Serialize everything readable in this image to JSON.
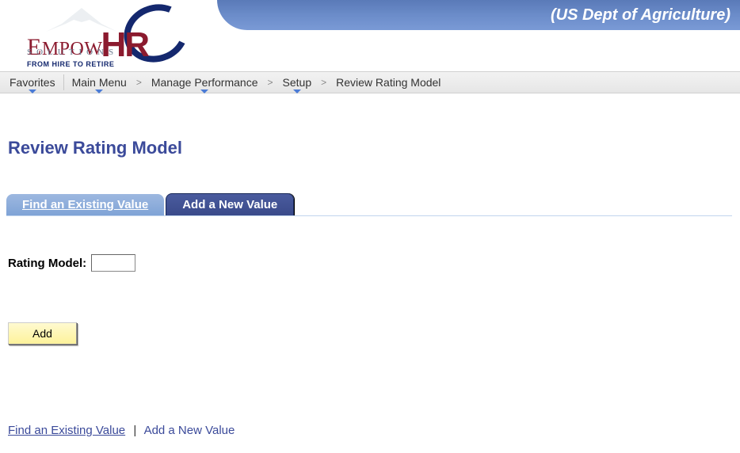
{
  "header": {
    "org_label": "(US Dept of Agriculture)",
    "logo": {
      "brand_prefix": "E",
      "brand_rest": "MPOW",
      "brand_suffix": "HR",
      "solutions": "SOLUTIONS",
      "tagline": "FROM HIRE TO RETIRE"
    }
  },
  "breadcrumb": {
    "items": [
      {
        "label": "Favorites",
        "has_menu": true
      },
      {
        "label": "Main Menu",
        "has_menu": true
      },
      {
        "label": "Manage Performance",
        "has_menu": true
      },
      {
        "label": "Setup",
        "has_menu": true
      },
      {
        "label": "Review Rating Model",
        "has_menu": false
      }
    ],
    "separator": ">"
  },
  "page": {
    "title": "Review Rating Model"
  },
  "tabs": {
    "find_access": "F",
    "find_rest": "ind an Existing Value",
    "add": "Add a New Value"
  },
  "form": {
    "rating_model_label": "Rating Model:",
    "rating_model_value": ""
  },
  "buttons": {
    "add": "Add"
  },
  "footer_links": {
    "find": "Find an Existing Value",
    "add": "Add a New Value",
    "pipe": "|"
  }
}
